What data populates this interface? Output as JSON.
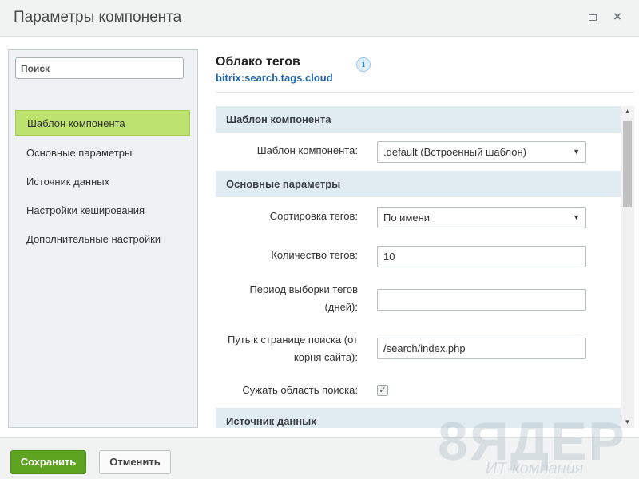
{
  "window": {
    "title": "Параметры компонента",
    "maximize_icon": "maximize-icon",
    "close_glyph": "×"
  },
  "sidebar": {
    "search_placeholder": "Поиск",
    "items": [
      {
        "label": "Шаблон компонента",
        "active": true
      },
      {
        "label": "Основные параметры",
        "active": false
      },
      {
        "label": "Источник данных",
        "active": false
      },
      {
        "label": "Настройки кеширования",
        "active": false
      },
      {
        "label": "Дополнительные настройки",
        "active": false
      }
    ]
  },
  "component": {
    "name": "Облако тегов",
    "code": "bitrix:search.tags.cloud",
    "info_glyph": "i"
  },
  "form": {
    "section_template": "Шаблон компонента",
    "template_label": "Шаблон компонента:",
    "template_value": ".default (Встроенный шаблон)",
    "section_main": "Основные параметры",
    "sort_label": "Сортировка тегов:",
    "sort_value": "По имени",
    "count_label": "Количество тегов:",
    "count_value": "10",
    "period_label_line1": "Период выборки тегов",
    "period_label_line2": "(дней):",
    "period_value": "",
    "path_label_line1": "Путь к странице поиска (от",
    "path_label_line2": "корня сайта):",
    "path_value": "/search/index.php",
    "narrow_label": "Сужать область поиска:",
    "narrow_checked": true,
    "check_glyph": "✓",
    "section_source": "Источник данных",
    "dropdown_glyph": "▼"
  },
  "scrollbar": {
    "up_glyph": "▲",
    "down_glyph": "▼"
  },
  "footer": {
    "save_label": "Сохранить",
    "cancel_label": "Отменить"
  },
  "watermark": {
    "big": "8ЯДЕР",
    "small": "ИТ-компания"
  },
  "colors": {
    "active_item": "#bde26f",
    "save_button": "#5ea421",
    "section_header": "#e0ebf2",
    "component_code": "#2066a9"
  }
}
